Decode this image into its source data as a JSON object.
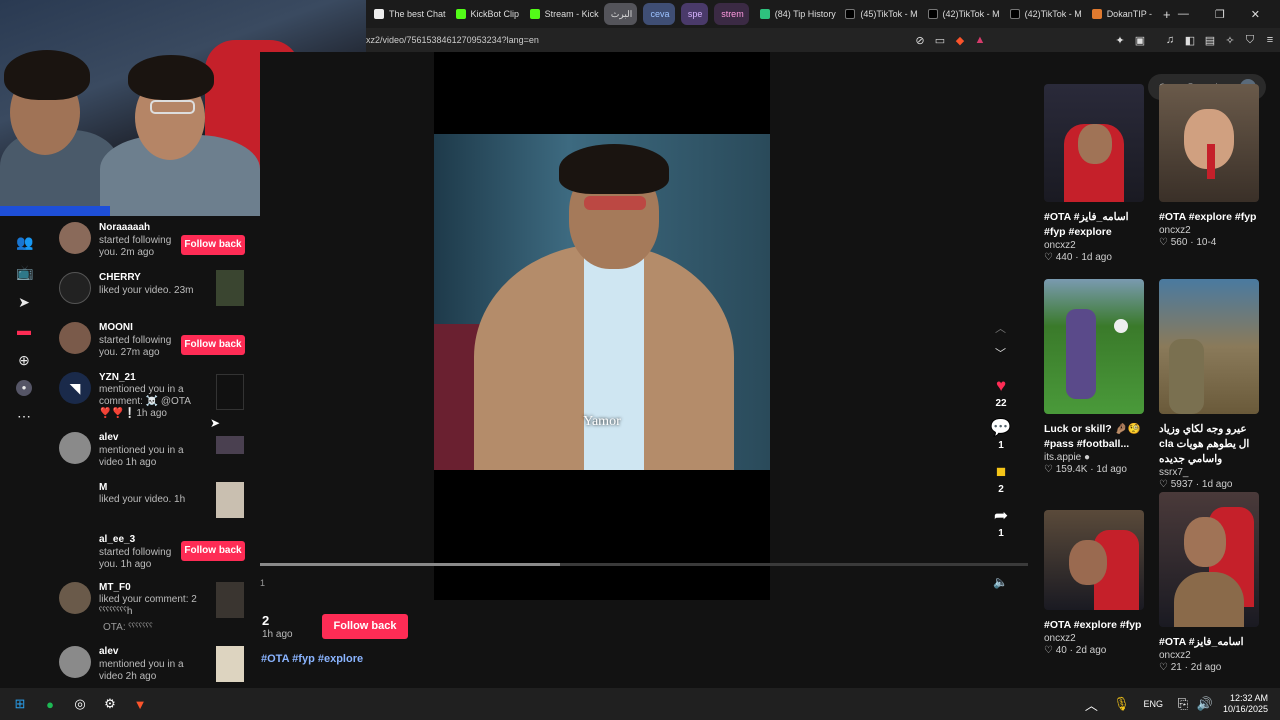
{
  "browser": {
    "tabs": [
      {
        "label": "The best Chat"
      },
      {
        "label": "KickBot Clip"
      },
      {
        "label": "Stream - Kick"
      },
      {
        "label": "البرث"
      },
      {
        "label": "ceva"
      },
      {
        "label": "spe"
      },
      {
        "label": "strem"
      },
      {
        "label": "(84) Tip History"
      },
      {
        "label": "(45)TikTok - M"
      },
      {
        "label": "(42)TikTok - M"
      },
      {
        "label": "(42)TikTok - M"
      },
      {
        "label": "DokanTIP -"
      }
    ],
    "new_tab": "+",
    "url": "xz2/video/7561538461270953234?lang=en"
  },
  "notifications": [
    {
      "name": "Noraaaaah",
      "text": "started following you. 2m ago",
      "action": "Follow back"
    },
    {
      "name": "CHERRY",
      "text": "liked your video. 23m"
    },
    {
      "name": "MOONI",
      "text": "started following you. 27m ago",
      "action": "Follow back"
    },
    {
      "name": "YZN_21",
      "text": "mentioned you in a comment: ☠️ @OTA",
      "extra": "❣️❣️❕1h ago"
    },
    {
      "name": "alev",
      "text": "mentioned you in a video 1h ago"
    },
    {
      "name": "M",
      "text": "liked your video. 1h"
    },
    {
      "name": "al_ee_3",
      "text": "started following you. 1h ago",
      "action": "Follow back"
    },
    {
      "name": "MT_F0",
      "text": "liked your comment: 2 ˤˤˤˤˤˤˤˤh",
      "extra": "OTA: ˤˤˤˤˤˤˤ"
    },
    {
      "name": "alev",
      "text": "mentioned you in a video 2h ago"
    }
  ],
  "video": {
    "caption_overlay": "Yamor",
    "progress": 0.39,
    "time_label": "1",
    "author_num": "2",
    "posted": "1h ago",
    "follow_label": "Follow back",
    "hashtags": "#OTA #fyp #explore",
    "actions": {
      "likes": "22",
      "comments": "1",
      "saves": "2",
      "shares": "1"
    }
  },
  "recommended": [
    {
      "title": "#OTA #اسامه_فايز #fyp #explore",
      "author": "oncxz2",
      "meta": "♡ 440 · 1d ago"
    },
    {
      "title": "#OTA #explore #fyp",
      "author": "oncxz2",
      "meta": "♡ 560 · 10-4"
    },
    {
      "title": "Luck or skill? 🤌🏽🧐 #pass #football...",
      "author": "its.appie ●",
      "meta": "♡ 159.4K · 1d ago"
    },
    {
      "title": "عيرو وجه لكاي وزياد cla ال يطوهم هويات واسامي جديده",
      "author": "ssrx7_",
      "meta": "♡ 5937 · 1d ago"
    },
    {
      "title": "#OTA #explore #fyp",
      "author": "oncxz2",
      "meta": "♡ 40 · 2d ago"
    },
    {
      "title": "#OTA #اسامه_فايز",
      "author": "oncxz2",
      "meta": "♡ 21 · 2d ago"
    }
  ],
  "taskbar": {
    "lang": "ENG",
    "time": "12:32 AM",
    "date": "10/16/2025"
  }
}
